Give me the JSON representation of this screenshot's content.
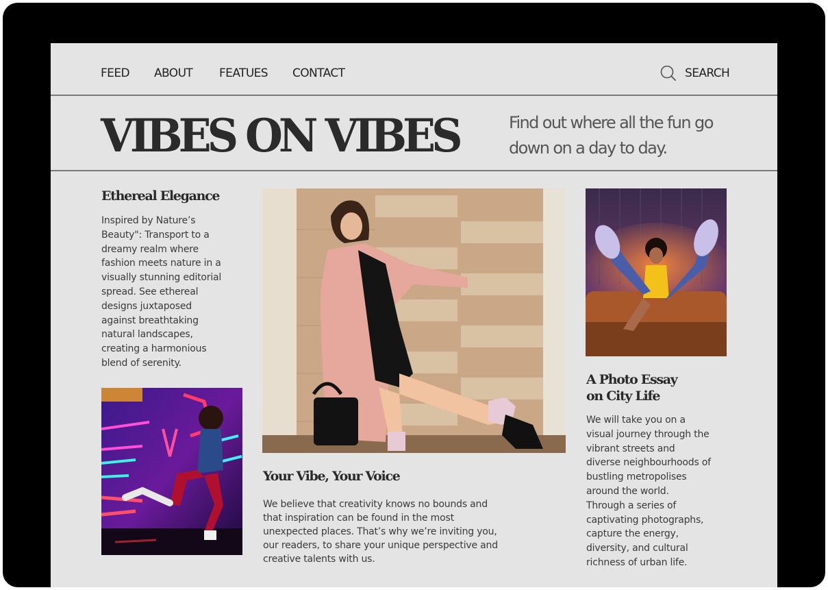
{
  "nav": {
    "items": [
      {
        "label": "FEED"
      },
      {
        "label": "ABOUT"
      },
      {
        "label": "FEATUES"
      },
      {
        "label": "CONTACT"
      }
    ],
    "search_label": "SEARCH",
    "search_icon": "search-icon"
  },
  "masthead": {
    "title": "VIBES ON VIBES",
    "tagline_line1": "Find out where all the fun go",
    "tagline_line2": "down on a day to day."
  },
  "left_column": {
    "title": "Ethereal Elegance",
    "body": [
      "Inspired by Nature’s",
      "Beauty\": Transport to a",
      "dreamy realm where",
      "fashion meets nature in a",
      "visually stunning editorial",
      "spread. See ethereal",
      "designs juxtaposed",
      "against breathtaking",
      "natural landscapes,",
      "creating a harmonious",
      "blend of serenity."
    ],
    "image": "neon-dancer-photo"
  },
  "center_column": {
    "image": "pink-coat-model-photo",
    "title": "Your Vibe, Your Voice",
    "body": [
      "We believe that creativity knows no bounds and",
      "that inspiration can be found in the most",
      "unexpected places. That’s why we’re inviting you,",
      "our readers, to share your unique perspective and",
      "creative talents with us."
    ]
  },
  "right_column": {
    "image": "couch-jump-photo",
    "title_line1": "A Photo Essay",
    "title_line2": "on City Life",
    "body": [
      "We will take you on a",
      "visual journey through the",
      "vibrant streets and",
      "diverse neighbourhoods of",
      "bustling metropolises",
      "around the world.",
      "Through a series of",
      "captivating photographs,",
      "capture the energy,",
      "diversity, and cultural",
      "richness of urban life."
    ]
  },
  "colors": {
    "page_bg": "#e4e4e4",
    "frame": "#000000",
    "text_dark": "#2b2b2b",
    "rule": "#7a7a7a"
  }
}
